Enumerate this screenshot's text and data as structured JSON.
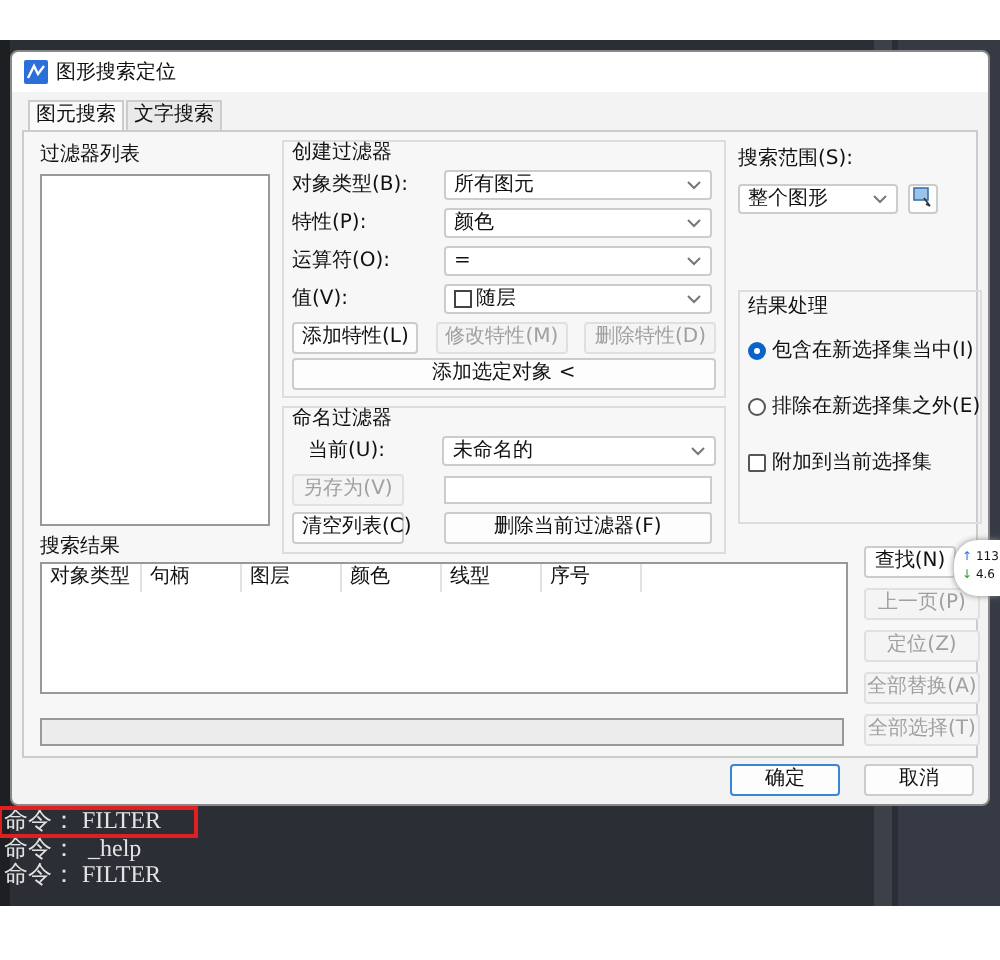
{
  "window": {
    "title": "图形搜索定位"
  },
  "tabs": [
    {
      "label": "图元搜索",
      "selected": true
    },
    {
      "label": "文字搜索",
      "selected": false
    }
  ],
  "filter_list": {
    "label": "过滤器列表"
  },
  "create_filter": {
    "title": "创建过滤器",
    "fields": [
      {
        "label": "对象类型(B):",
        "value": "所有图元"
      },
      {
        "label": "特性(P):",
        "value": "颜色"
      },
      {
        "label": "运算符(O):",
        "value": "="
      },
      {
        "label": "值(V):",
        "value": "随层",
        "kind": "swatch"
      }
    ],
    "buttons": [
      {
        "label": "添加特性(L)",
        "disabled": false
      },
      {
        "label": "修改特性(M)",
        "disabled": true
      },
      {
        "label": "删除特性(D)",
        "disabled": true
      }
    ],
    "add_selected": "添加选定对象 <"
  },
  "named_filter": {
    "title": "命名过滤器",
    "current_label": "当前(U):",
    "current_value": "未命名的",
    "save_as": {
      "label": "另存为(V)",
      "disabled": true
    },
    "clear": {
      "label": "清空列表(C)",
      "disabled": false
    },
    "delete": {
      "label": "删除当前过滤器(F)",
      "disabled": false
    }
  },
  "search_scope": {
    "label": "搜索范围(S):",
    "value": "整个图形"
  },
  "result_handling": {
    "title": "结果处理",
    "options": [
      {
        "kind": "radio",
        "label": "包含在新选择集当中(I)",
        "selected": true
      },
      {
        "kind": "radio",
        "label": "排除在新选择集之外(E)",
        "selected": false
      },
      {
        "kind": "checkbox",
        "label": "附加到当前选择集",
        "checked": false
      }
    ]
  },
  "results": {
    "label": "搜索结果",
    "columns": [
      "对象类型",
      "句柄",
      "图层",
      "颜色",
      "线型",
      "序号"
    ]
  },
  "side_buttons": [
    {
      "label": "查找(N)",
      "disabled": false
    },
    {
      "label": "上一页(P)",
      "disabled": true
    },
    {
      "label": "定位(Z)",
      "disabled": true
    },
    {
      "label": "全部替换(A)",
      "disabled": true
    },
    {
      "label": "全部选择(T)",
      "disabled": true
    }
  ],
  "footer_buttons": [
    {
      "label": "确定",
      "default": true
    },
    {
      "label": "取消",
      "default": false
    }
  ],
  "console": {
    "lines": [
      {
        "text": "命令： FILTER",
        "highlighted": true
      },
      {
        "text": "命令：  _help",
        "highlighted": false
      },
      {
        "text": "命令： FILTER",
        "highlighted": false
      }
    ]
  },
  "speed_widget": {
    "up_arrow": "↑",
    "upload": "113",
    "down_arrow": "↓",
    "download": "4.6"
  }
}
